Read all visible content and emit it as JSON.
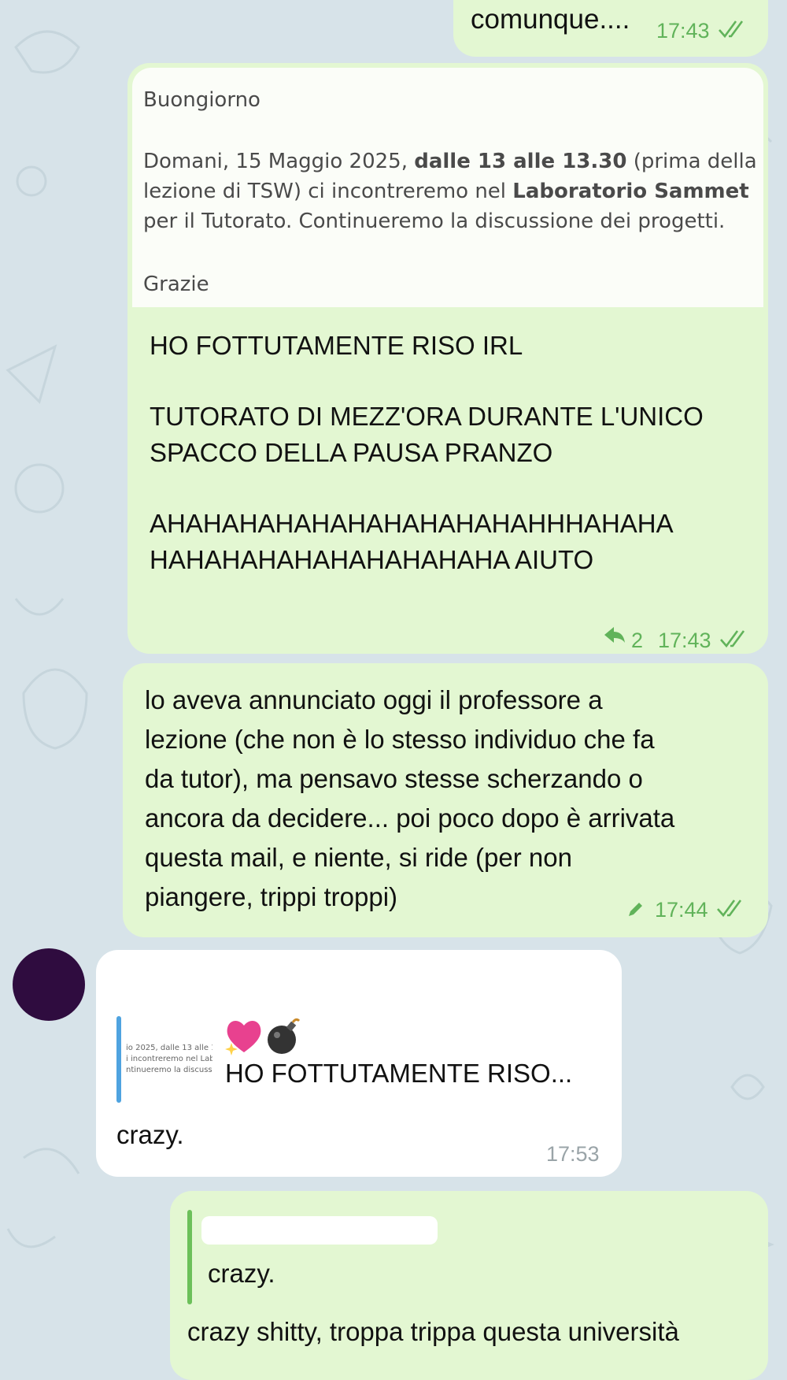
{
  "messages": {
    "m1": {
      "text": "comunque....",
      "time": "17:43"
    },
    "m2": {
      "quoted": {
        "greeting": "Buongiorno",
        "b1": "Domani, 15 Maggio 2025, ",
        "b1_bold": "dalle 13 alle 13.30",
        "b1_rest": " (prima della",
        "b2": "lezione di TSW) ci incontreremo nel ",
        "b2_bold": "Laboratorio Sammet",
        "b3": "per il Tutorato. Continueremo la discussione dei progetti.",
        "thanks": "Grazie"
      },
      "lines": [
        "HO FOTTUTAMENTE RISO IRL",
        "TUTORATO DI MEZZ'ORA DURANTE L'UNICO",
        "SPACCO DELLA PAUSA PRANZO",
        "AHAHAHAHAHAHAHAHAHAHAHHHAHAHA",
        "HAHAHAHAHAHAHAHAHAHA AIUTO"
      ],
      "replies": "2",
      "time": "17:43"
    },
    "m3": {
      "lines": [
        "lo aveva annunciato oggi il professore a",
        "lezione (che non è lo stesso individuo che fa",
        "da tutor), ma pensavo stesse scherzando o",
        "ancora da decidere... poi poco dopo è arrivata",
        "questa mail, e niente, si ride (per non",
        "piangere, trippi troppi)"
      ],
      "time": "17:44"
    },
    "m4": {
      "thumb_lines": [
        "io 2025, dalle 13 alle 1",
        "i incontreremo nel Lab",
        "ntinueremo la discussi"
      ],
      "reply_snippet": "HO FOTTUTAMENTE RISO...",
      "text": "crazy.",
      "time": "17:53"
    },
    "m5": {
      "quote_text": "crazy.",
      "text": "crazy shitty, troppa trippa questa università"
    }
  },
  "icons": {
    "read": "double-check-icon",
    "reply": "reply-arrow-icon",
    "edited": "pencil-icon",
    "heart": "sparkling-heart-emoji",
    "bomb": "bomb-emoji"
  },
  "colors": {
    "background": "#d7e3e9",
    "outgoing": "#e3f7d2",
    "incoming": "#ffffff",
    "accent_green": "#61b35a",
    "reply_bar_blue": "#4fa3e0",
    "reply_bar_green": "#6cc05a",
    "avatar": "#2f0c3f"
  }
}
